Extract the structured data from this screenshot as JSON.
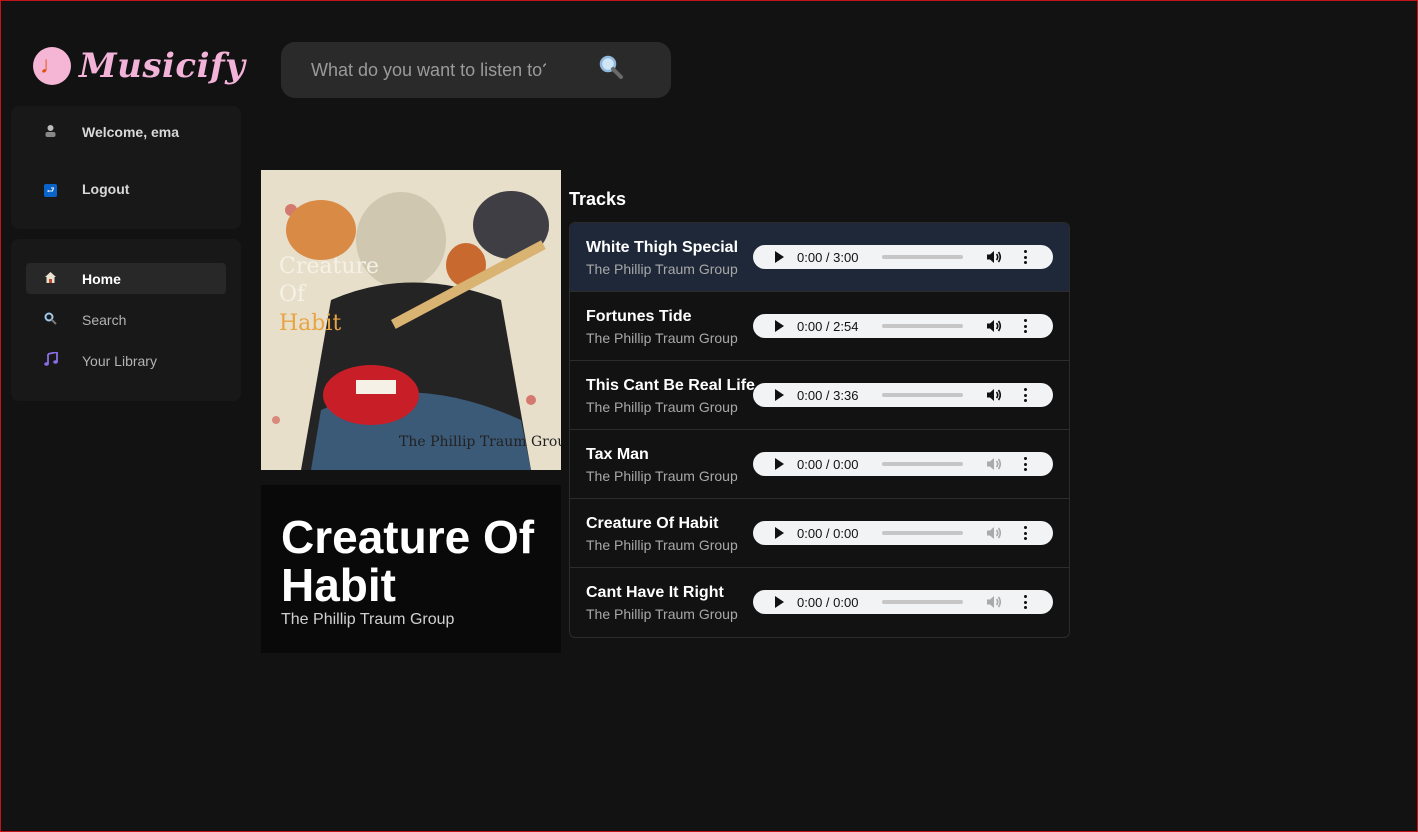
{
  "app": {
    "name": "Musicify"
  },
  "user_panel": {
    "welcome": "Welcome, ema",
    "logout": "Logout"
  },
  "nav": {
    "items": [
      {
        "label": "Home",
        "icon": "home-icon",
        "active": true
      },
      {
        "label": "Search",
        "icon": "search-icon",
        "active": false
      },
      {
        "label": "Your Library",
        "icon": "music-note-icon",
        "active": false
      }
    ]
  },
  "search": {
    "placeholder": "What do you want to listen to?"
  },
  "album": {
    "title": "Creature Of Habit",
    "artist": "The Phillip Traum Group",
    "cover_text": [
      "Creature",
      "Of",
      "Habit"
    ],
    "cover_signature": "The Phillip Traum Group"
  },
  "tracks_heading": "Tracks",
  "tracks": [
    {
      "name": "White Thigh Special",
      "artist": "The Phillip Traum Group",
      "time": "0:00 / 3:00",
      "progress": 0.38,
      "enabled": true,
      "selected": true
    },
    {
      "name": "Fortunes Tide",
      "artist": "The Phillip Traum Group",
      "time": "0:00 / 2:54",
      "progress": 0.4,
      "enabled": true,
      "selected": false
    },
    {
      "name": "This Cant Be Real Life",
      "artist": "The Phillip Traum Group",
      "time": "0:00 / 3:36",
      "progress": 0.32,
      "enabled": true,
      "selected": false
    },
    {
      "name": "Tax Man",
      "artist": "The Phillip Traum Group",
      "time": "0:00 / 0:00",
      "progress": 0,
      "enabled": false,
      "selected": false
    },
    {
      "name": "Creature Of Habit",
      "artist": "The Phillip Traum Group",
      "time": "0:00 / 0:00",
      "progress": 0,
      "enabled": false,
      "selected": false
    },
    {
      "name": "Cant Have It Right",
      "artist": "The Phillip Traum Group",
      "time": "0:00 / 0:00",
      "progress": 0,
      "enabled": false,
      "selected": false
    }
  ],
  "colors": {
    "background": "#121212",
    "panel": "#181818",
    "logo_pink": "#f3b2d8",
    "selected_row": "#1e2838"
  }
}
